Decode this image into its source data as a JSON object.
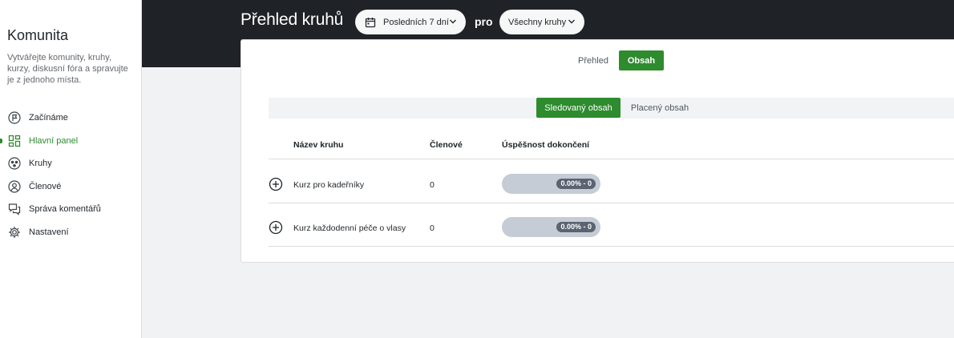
{
  "sidebar": {
    "title": "Komunita",
    "description": "Vytvářejte komunity, kruhy, kurzy, diskusní fóra a spravujte je z jednoho místa.",
    "items": [
      {
        "label": "Začínáme",
        "icon": "flag-circle-icon"
      },
      {
        "label": "Hlavní panel",
        "icon": "dashboard-icon",
        "active": true
      },
      {
        "label": "Kruhy",
        "icon": "circles-icon"
      },
      {
        "label": "Členové",
        "icon": "user-circle-icon"
      },
      {
        "label": "Správa komentářů",
        "icon": "comments-icon"
      },
      {
        "label": "Nastavení",
        "icon": "gear-icon"
      }
    ]
  },
  "header": {
    "title": "Přehled kruhů",
    "range_label": "Posledních 7 dní",
    "connector": "pro",
    "circles_label": "Všechny kruhy"
  },
  "tabs": {
    "overview": "Přehled",
    "content": "Obsah"
  },
  "subtabs": {
    "tracked": "Sledovaný obsah",
    "paid": "Placený obsah"
  },
  "table": {
    "columns": [
      "Název kruhu",
      "Členové",
      "Úspěšnost dokončení"
    ],
    "rows": [
      {
        "name": "Kurz pro kadeřníky",
        "members": "0",
        "completion": "0.00% - 0",
        "completion_pct": 0
      },
      {
        "name": "Kurz každodenní péče o vlasy",
        "members": "0",
        "completion": "0.00% - 0",
        "completion_pct": 0
      }
    ]
  },
  "colors": {
    "accent": "#2e8b2e",
    "header_bg": "#1f2327"
  }
}
